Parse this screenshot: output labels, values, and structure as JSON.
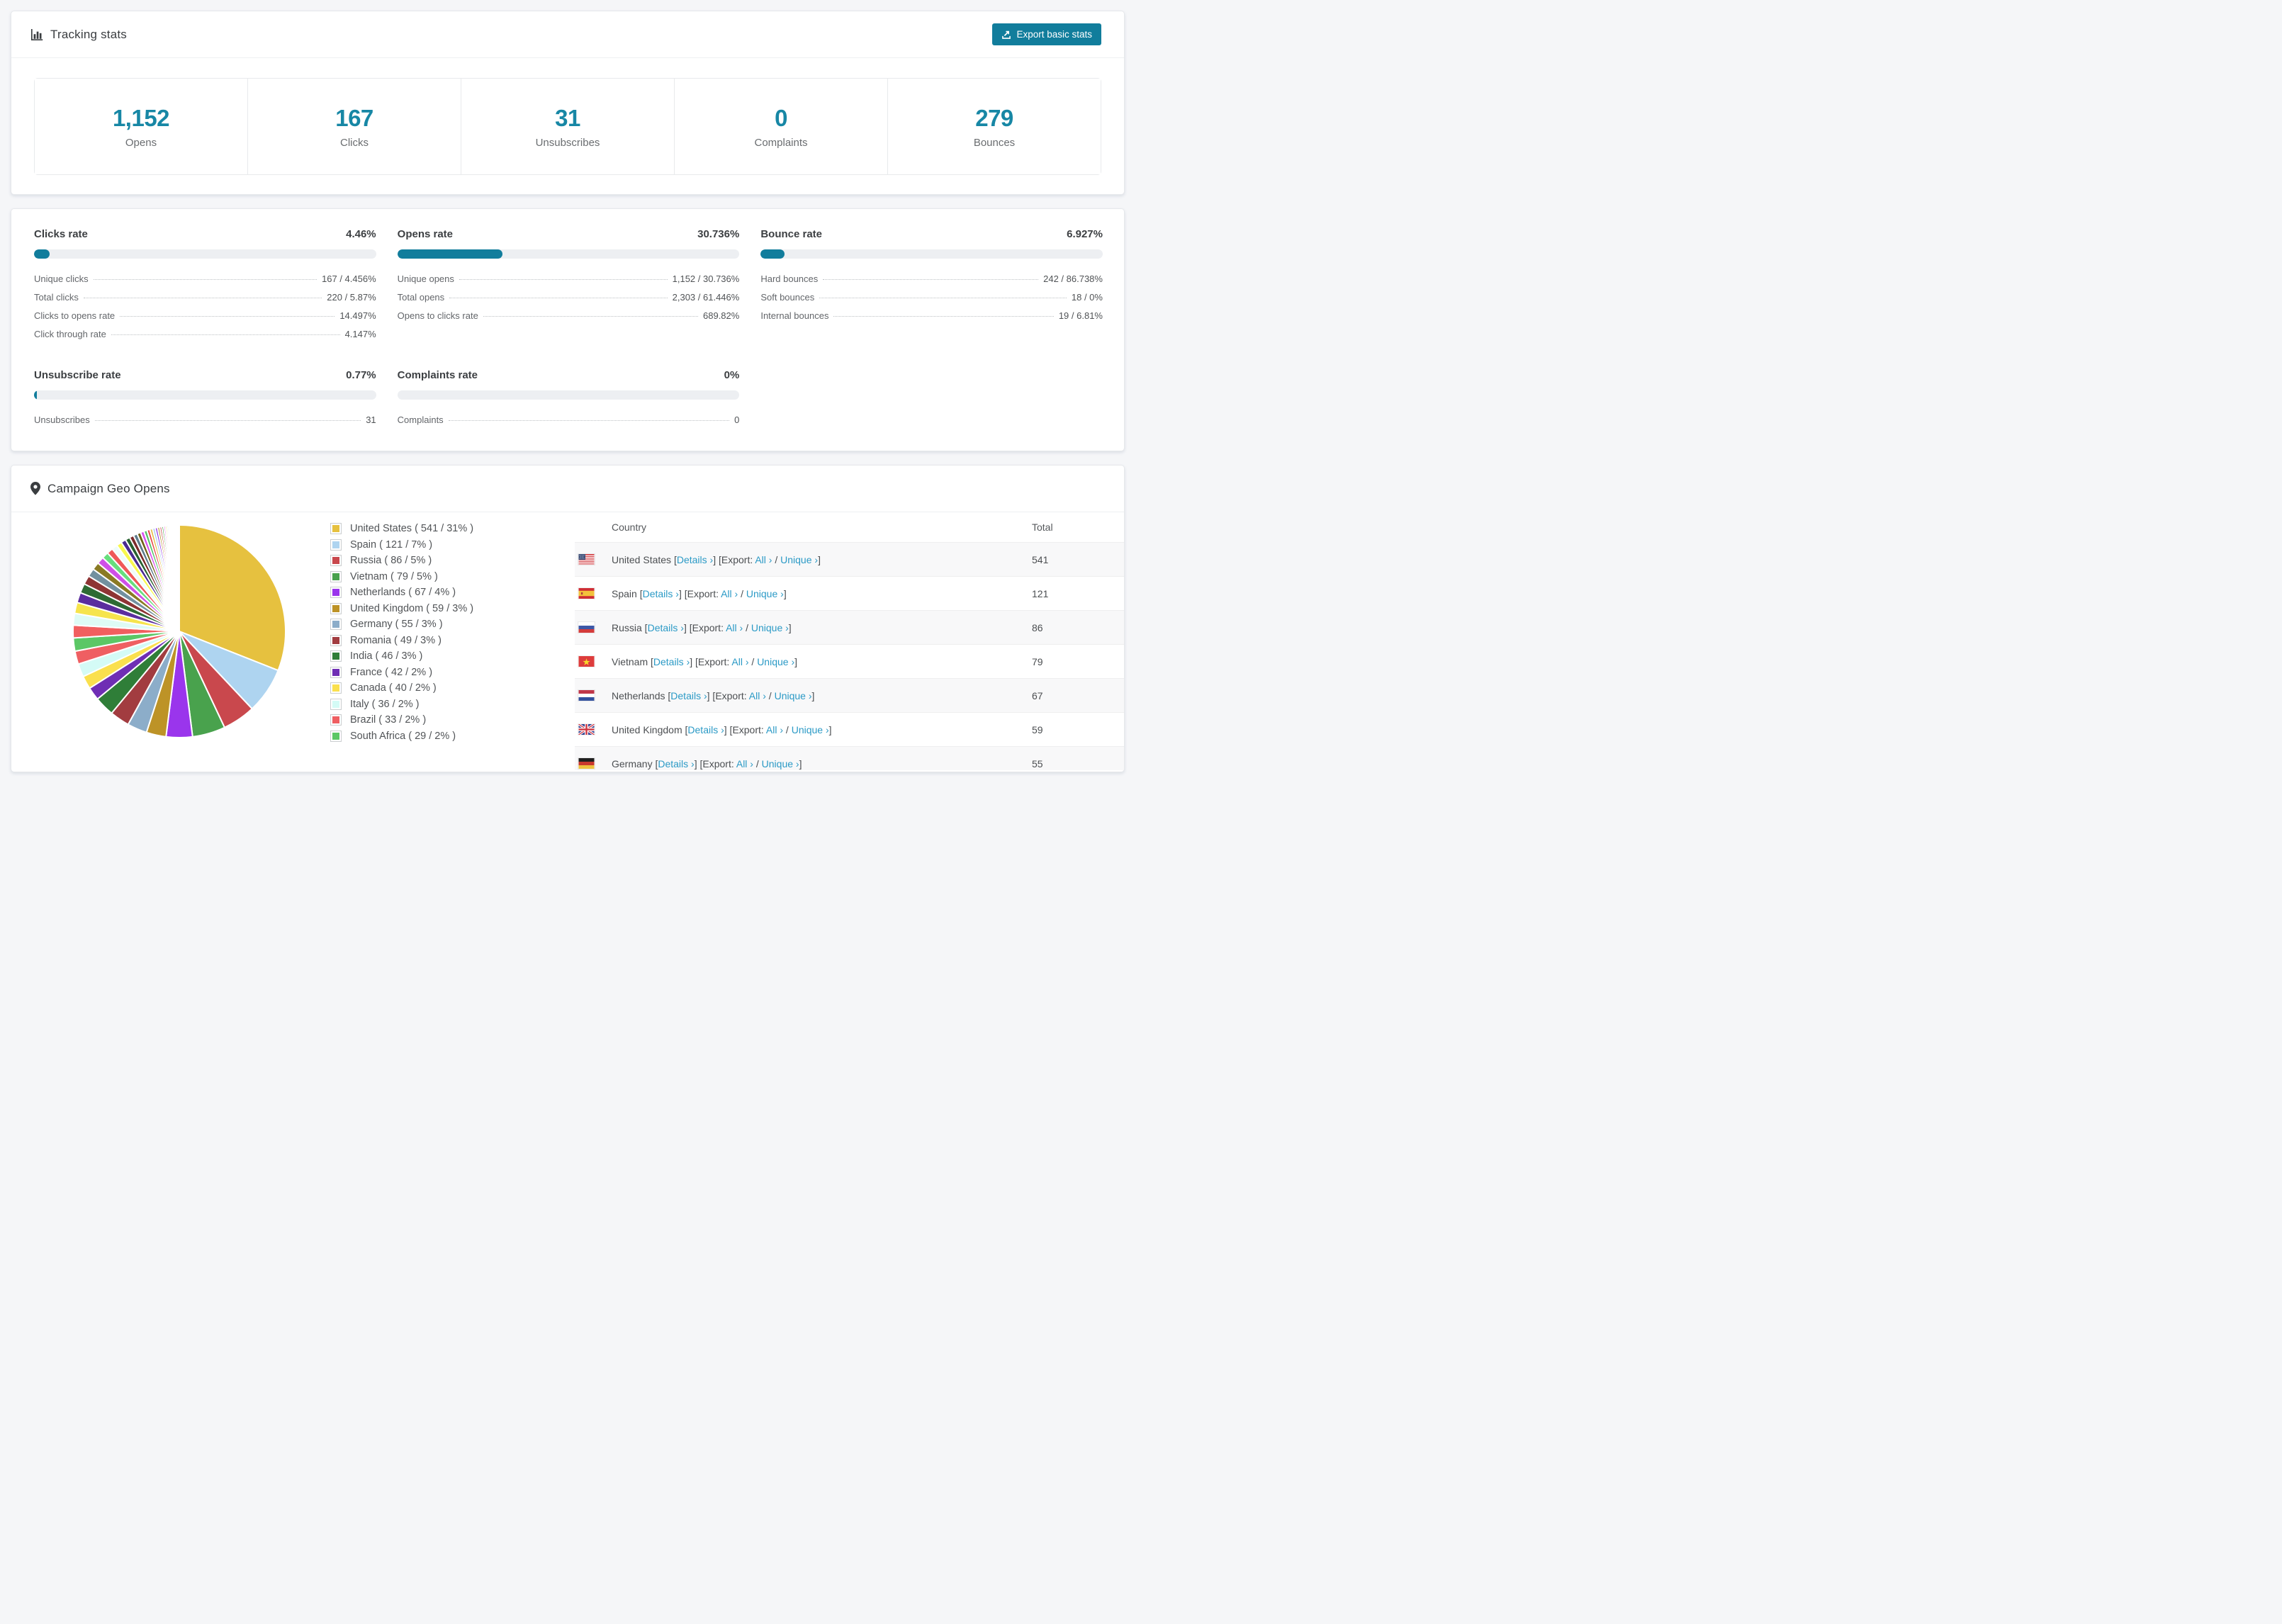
{
  "theme": {
    "accent": "#117d9c",
    "stat_number": "#1787a5",
    "link": "#2b9ac6",
    "bar_track": "#edeff2"
  },
  "tracking": {
    "title": "Tracking stats",
    "export_button": "Export basic stats",
    "stats": [
      {
        "value": "1,152",
        "label": "Opens"
      },
      {
        "value": "167",
        "label": "Clicks"
      },
      {
        "value": "31",
        "label": "Unsubscribes"
      },
      {
        "value": "0",
        "label": "Complaints"
      },
      {
        "value": "279",
        "label": "Bounces"
      }
    ]
  },
  "rates": {
    "blocks": [
      {
        "title": "Clicks rate",
        "value": "4.46%",
        "bar_pct": 4.46,
        "rows": [
          {
            "label": "Unique clicks",
            "value": "167 / 4.456%"
          },
          {
            "label": "Total clicks",
            "value": "220 / 5.87%"
          },
          {
            "label": "Clicks to opens rate",
            "value": "14.497%"
          },
          {
            "label": "Click through rate",
            "value": "4.147%"
          }
        ]
      },
      {
        "title": "Opens rate",
        "value": "30.736%",
        "bar_pct": 30.736,
        "rows": [
          {
            "label": "Unique opens",
            "value": "1,152 / 30.736%"
          },
          {
            "label": "Total opens",
            "value": "2,303 / 61.446%"
          },
          {
            "label": "Opens to clicks rate",
            "value": "689.82%"
          }
        ]
      },
      {
        "title": "Bounce rate",
        "value": "6.927%",
        "bar_pct": 6.927,
        "rows": [
          {
            "label": "Hard bounces",
            "value": "242 / 86.738%"
          },
          {
            "label": "Soft bounces",
            "value": "18 / 0%"
          },
          {
            "label": "Internal bounces",
            "value": "19 / 6.81%"
          }
        ]
      },
      {
        "title": "Unsubscribe rate",
        "value": "0.77%",
        "bar_pct": 0.77,
        "rows": [
          {
            "label": "Unsubscribes",
            "value": "31"
          }
        ]
      },
      {
        "title": "Complaints rate",
        "value": "0%",
        "bar_pct": 0,
        "rows": [
          {
            "label": "Complaints",
            "value": "0"
          }
        ]
      }
    ]
  },
  "geo": {
    "title": "Campaign Geo Opens",
    "legend": [
      {
        "label": "United States ( 541 / 31% )",
        "color": "#e6c13f"
      },
      {
        "label": "Spain ( 121 / 7% )",
        "color": "#aed4f0"
      },
      {
        "label": "Russia ( 86 / 5% )",
        "color": "#c9484d"
      },
      {
        "label": "Vietnam ( 79 / 5% )",
        "color": "#49a24d"
      },
      {
        "label": "Netherlands ( 67 / 4% )",
        "color": "#9a35ec"
      },
      {
        "label": "United Kingdom ( 59 / 3% )",
        "color": "#bd9327"
      },
      {
        "label": "Germany ( 55 / 3% )",
        "color": "#8cadc9"
      },
      {
        "label": "Romania ( 49 / 3% )",
        "color": "#a23c40"
      },
      {
        "label": "India ( 46 / 3% )",
        "color": "#2f7e38"
      },
      {
        "label": "France ( 42 / 2% )",
        "color": "#6f2eb4"
      },
      {
        "label": "Canada ( 40 / 2% )",
        "color": "#fae04e"
      },
      {
        "label": "Italy ( 36 / 2% )",
        "color": "#d4fbf6"
      },
      {
        "label": "Brazil ( 33 / 2% )",
        "color": "#ef5f62"
      },
      {
        "label": "South Africa ( 29 / 2% )",
        "color": "#5bc765"
      }
    ],
    "table": {
      "headers": [
        "Country",
        "Total"
      ],
      "links": {
        "open_bracket": " [",
        "details": "Details ›",
        "close_open": "] [",
        "export_label": "Export: ",
        "all": "All ›",
        "slash": " / ",
        "unique": "Unique ›",
        "close_bracket": "]"
      },
      "rows": [
        {
          "country": "United States",
          "flag": "us",
          "total": "541"
        },
        {
          "country": "Spain",
          "flag": "es",
          "total": "121"
        },
        {
          "country": "Russia",
          "flag": "ru",
          "total": "86"
        },
        {
          "country": "Vietnam",
          "flag": "vn",
          "total": "79"
        },
        {
          "country": "Netherlands",
          "flag": "nl",
          "total": "67"
        },
        {
          "country": "United Kingdom",
          "flag": "gb",
          "total": "59"
        },
        {
          "country": "Germany",
          "flag": "de",
          "total": "55"
        }
      ]
    }
  },
  "chart_data": {
    "type": "pie",
    "title": "Campaign Geo Opens",
    "unit": "opens",
    "start_at": "12-o-clock, clockwise",
    "legend_position": "right",
    "slices": [
      {
        "label": "United States",
        "value": 541,
        "pct": 31,
        "color": "#e6c13f"
      },
      {
        "label": "Spain",
        "value": 121,
        "pct": 7,
        "color": "#aed4f0"
      },
      {
        "label": "Russia",
        "value": 86,
        "pct": 5,
        "color": "#c9484d"
      },
      {
        "label": "Vietnam",
        "value": 79,
        "pct": 5,
        "color": "#49a24d"
      },
      {
        "label": "Netherlands",
        "value": 67,
        "pct": 4,
        "color": "#9a35ec"
      },
      {
        "label": "United Kingdom",
        "value": 59,
        "pct": 3,
        "color": "#bd9327"
      },
      {
        "label": "Germany",
        "value": 55,
        "pct": 3,
        "color": "#8cadc9"
      },
      {
        "label": "Romania",
        "value": 49,
        "pct": 3,
        "color": "#a23c40"
      },
      {
        "label": "India",
        "value": 46,
        "pct": 3,
        "color": "#2f7e38"
      },
      {
        "label": "France",
        "value": 42,
        "pct": 2,
        "color": "#6f2eb4"
      },
      {
        "label": "Canada",
        "value": 40,
        "pct": 2,
        "color": "#fae04e"
      },
      {
        "label": "Italy",
        "value": 36,
        "pct": 2,
        "color": "#d4fbf6"
      },
      {
        "label": "Brazil",
        "value": 33,
        "pct": 2,
        "color": "#ef5f62"
      },
      {
        "label": "South Africa",
        "value": 29,
        "pct": 2,
        "color": "#5bc765"
      }
    ],
    "others": {
      "total_pct": 26,
      "slice_count": 40,
      "decay": 0.93,
      "palette": [
        "#f15f5f",
        "#defbf5",
        "#f6e44c",
        "#5b2d9e",
        "#2e6b34",
        "#8e3434",
        "#72909f",
        "#8a7a24",
        "#cf4fe8",
        "#67de7d",
        "#ef5858",
        "#eefcfa",
        "#f8f84e",
        "#4a2a8f",
        "#27602f",
        "#7c2a2a",
        "#5c7a8a",
        "#6f6118",
        "#d84ff0",
        "#55c368",
        "#e84b4b",
        "#e5c04b",
        "#a9cdee",
        "#8e30e8",
        "#b8952f",
        "#c8494b",
        "#43a047",
        "#e361f0",
        "#f0e14b",
        "#9fd4f2",
        "#d94343",
        "#2d7a35",
        "#4b2f94",
        "#e2b93b",
        "#aacfee",
        "#c94c4e",
        "#46a04a",
        "#9333ea",
        "#b8962e",
        "#7f9cb5"
      ]
    }
  }
}
